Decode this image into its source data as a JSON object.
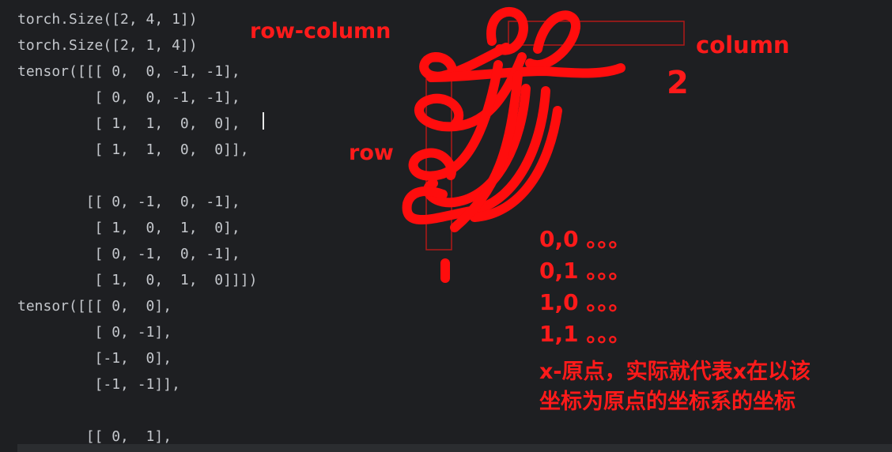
{
  "console": {
    "lines": [
      "torch.Size([2, 4, 1])",
      "torch.Size([2, 1, 4])",
      "tensor([[[ 0,  0, -1, -1],",
      "         [ 0,  0, -1, -1],",
      "         [ 1,  1,  0,  0],",
      "         [ 1,  1,  0,  0]],",
      "",
      "        [[ 0, -1,  0, -1],",
      "         [ 1,  0,  1,  0],",
      "         [ 0, -1,  0, -1],",
      "         [ 1,  0,  1,  0]]])",
      "tensor([[[ 0,  0],",
      "         [ 0, -1],",
      "         [-1,  0],",
      "         [-1, -1]],",
      "",
      "        [[ 0,  1],"
    ]
  },
  "annotations": {
    "row_column_label": "row-column",
    "column_label": "column",
    "row_label": "row",
    "column_dim_digit": "2",
    "row_dim_digit": "1",
    "index_list": [
      "0,0 。。。",
      "0,1 。。。",
      "1,0 。。。",
      "1,1 。。。"
    ],
    "note_lines": [
      "x-原点，实际就代表x在以该",
      "坐标为原点的坐标系的坐标"
    ]
  },
  "colors": {
    "background": "#1e1f22",
    "code_text": "#c4c7cc",
    "annotation": "#ff1a1a"
  }
}
